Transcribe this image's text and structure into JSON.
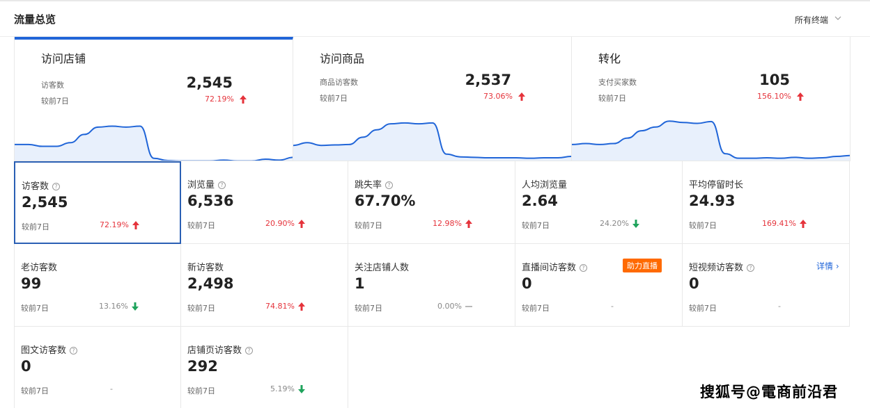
{
  "header": {
    "title": "流量总览",
    "terminal": "所有终端",
    "chevron_icon": "chevron-down-icon"
  },
  "cards": [
    {
      "title": "访问店铺",
      "metric_label": "访客数",
      "value": "2,545",
      "compare_label": "较前7日",
      "change": "72.19%",
      "trend": "up",
      "series": [
        0.38,
        0.38,
        0.34,
        0.34,
        0.42,
        0.6,
        0.76,
        0.78,
        0.76,
        0.78,
        0.08,
        0.03,
        0.02,
        0.02,
        0.02,
        0.04,
        0.02,
        0.02,
        0.06,
        0.04,
        0.1
      ]
    },
    {
      "title": "访问商品",
      "metric_label": "商品访客数",
      "value": "2,537",
      "compare_label": "较前7日",
      "change": "73.06%",
      "trend": "up",
      "series": [
        0.3,
        0.36,
        0.3,
        0.31,
        0.32,
        0.48,
        0.64,
        0.77,
        0.79,
        0.77,
        0.79,
        0.11,
        0.05,
        0.04,
        0.03,
        0.03,
        0.03,
        0.02,
        0.03,
        0.03,
        0.06
      ]
    },
    {
      "title": "转化",
      "metric_label": "支付买家数",
      "value": "105",
      "compare_label": "较前7日",
      "change": "156.10%",
      "trend": "up",
      "series": [
        0.32,
        0.34,
        0.32,
        0.34,
        0.46,
        0.62,
        0.7,
        0.83,
        0.8,
        0.78,
        0.82,
        0.12,
        0.02,
        0.02,
        0.03,
        0.02,
        0.04,
        0.02,
        0.03,
        0.06,
        0.08
      ]
    }
  ],
  "metrics": [
    {
      "label": "访客数",
      "help": true,
      "value": "2,545",
      "compare_label": "较前7日",
      "change": "72.19%",
      "trend": "up",
      "selected": true
    },
    {
      "label": "浏览量",
      "help": true,
      "value": "6,536",
      "compare_label": "较前7日",
      "change": "20.90%",
      "trend": "up"
    },
    {
      "label": "跳失率",
      "help": true,
      "value": "67.70%",
      "compare_label": "较前7日",
      "change": "12.98%",
      "trend": "up"
    },
    {
      "label": "人均浏览量",
      "help": false,
      "value": "2.64",
      "compare_label": "较前7日",
      "change": "24.20%",
      "trend": "down"
    },
    {
      "label": "平均停留时长",
      "help": false,
      "value": "24.93",
      "compare_label": "较前7日",
      "change": "169.41%",
      "trend": "up"
    },
    {
      "label": "老访客数",
      "help": false,
      "value": "99",
      "compare_label": "较前7日",
      "change": "13.16%",
      "trend": "down"
    },
    {
      "label": "新访客数",
      "help": false,
      "value": "2,498",
      "compare_label": "较前7日",
      "change": "74.81%",
      "trend": "up"
    },
    {
      "label": "关注店铺人数",
      "help": false,
      "value": "1",
      "compare_label": "较前7日",
      "change": "0.00%",
      "trend": "flat"
    },
    {
      "label": "直播间访客数",
      "help": true,
      "value": "0",
      "compare_label": "较前7日",
      "change": "-",
      "trend": "none",
      "badge": "助力直播"
    },
    {
      "label": "短视频访客数",
      "help": true,
      "value": "0",
      "compare_label": "较前7日",
      "change": "-",
      "trend": "none",
      "link": "详情"
    },
    {
      "label": "图文访客数",
      "help": true,
      "value": "0",
      "compare_label": "较前7日",
      "change": "-",
      "trend": "none"
    },
    {
      "label": "店铺页访客数",
      "help": true,
      "value": "292",
      "compare_label": "较前7日",
      "change": "5.19%",
      "trend": "down"
    }
  ],
  "colors": {
    "accent": "#2065d8",
    "up": "#e5333b",
    "down": "#1fa35c",
    "badge": "#ff6a00",
    "area_fill": "#e8f0fc"
  },
  "watermark": "搜狐号@電商前沿君"
}
